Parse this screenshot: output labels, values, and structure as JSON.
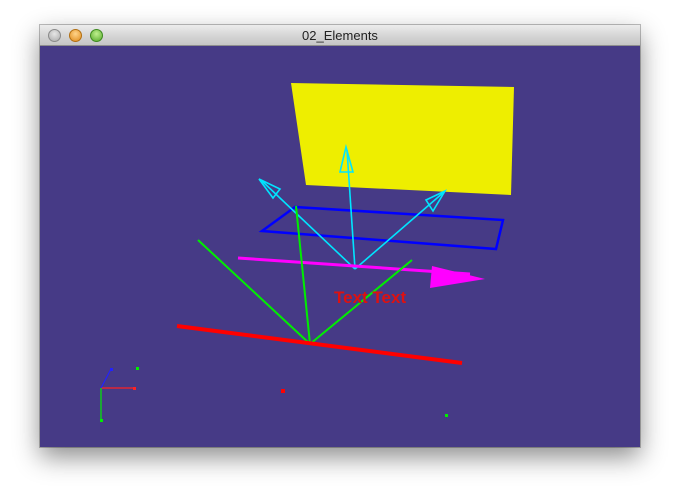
{
  "window": {
    "title": "02_Elements"
  },
  "scene": {
    "background_color": "#463a86",
    "label_text": "Text Text",
    "colors": {
      "plane": "#eeee00",
      "cyan_arrows": "#00e5ff",
      "blue_rect": "#0000ff",
      "magenta_arrow": "#ff00ff",
      "green_lines": "#00ee00",
      "red_line": "#ff0000",
      "label": "#dd1111"
    }
  }
}
